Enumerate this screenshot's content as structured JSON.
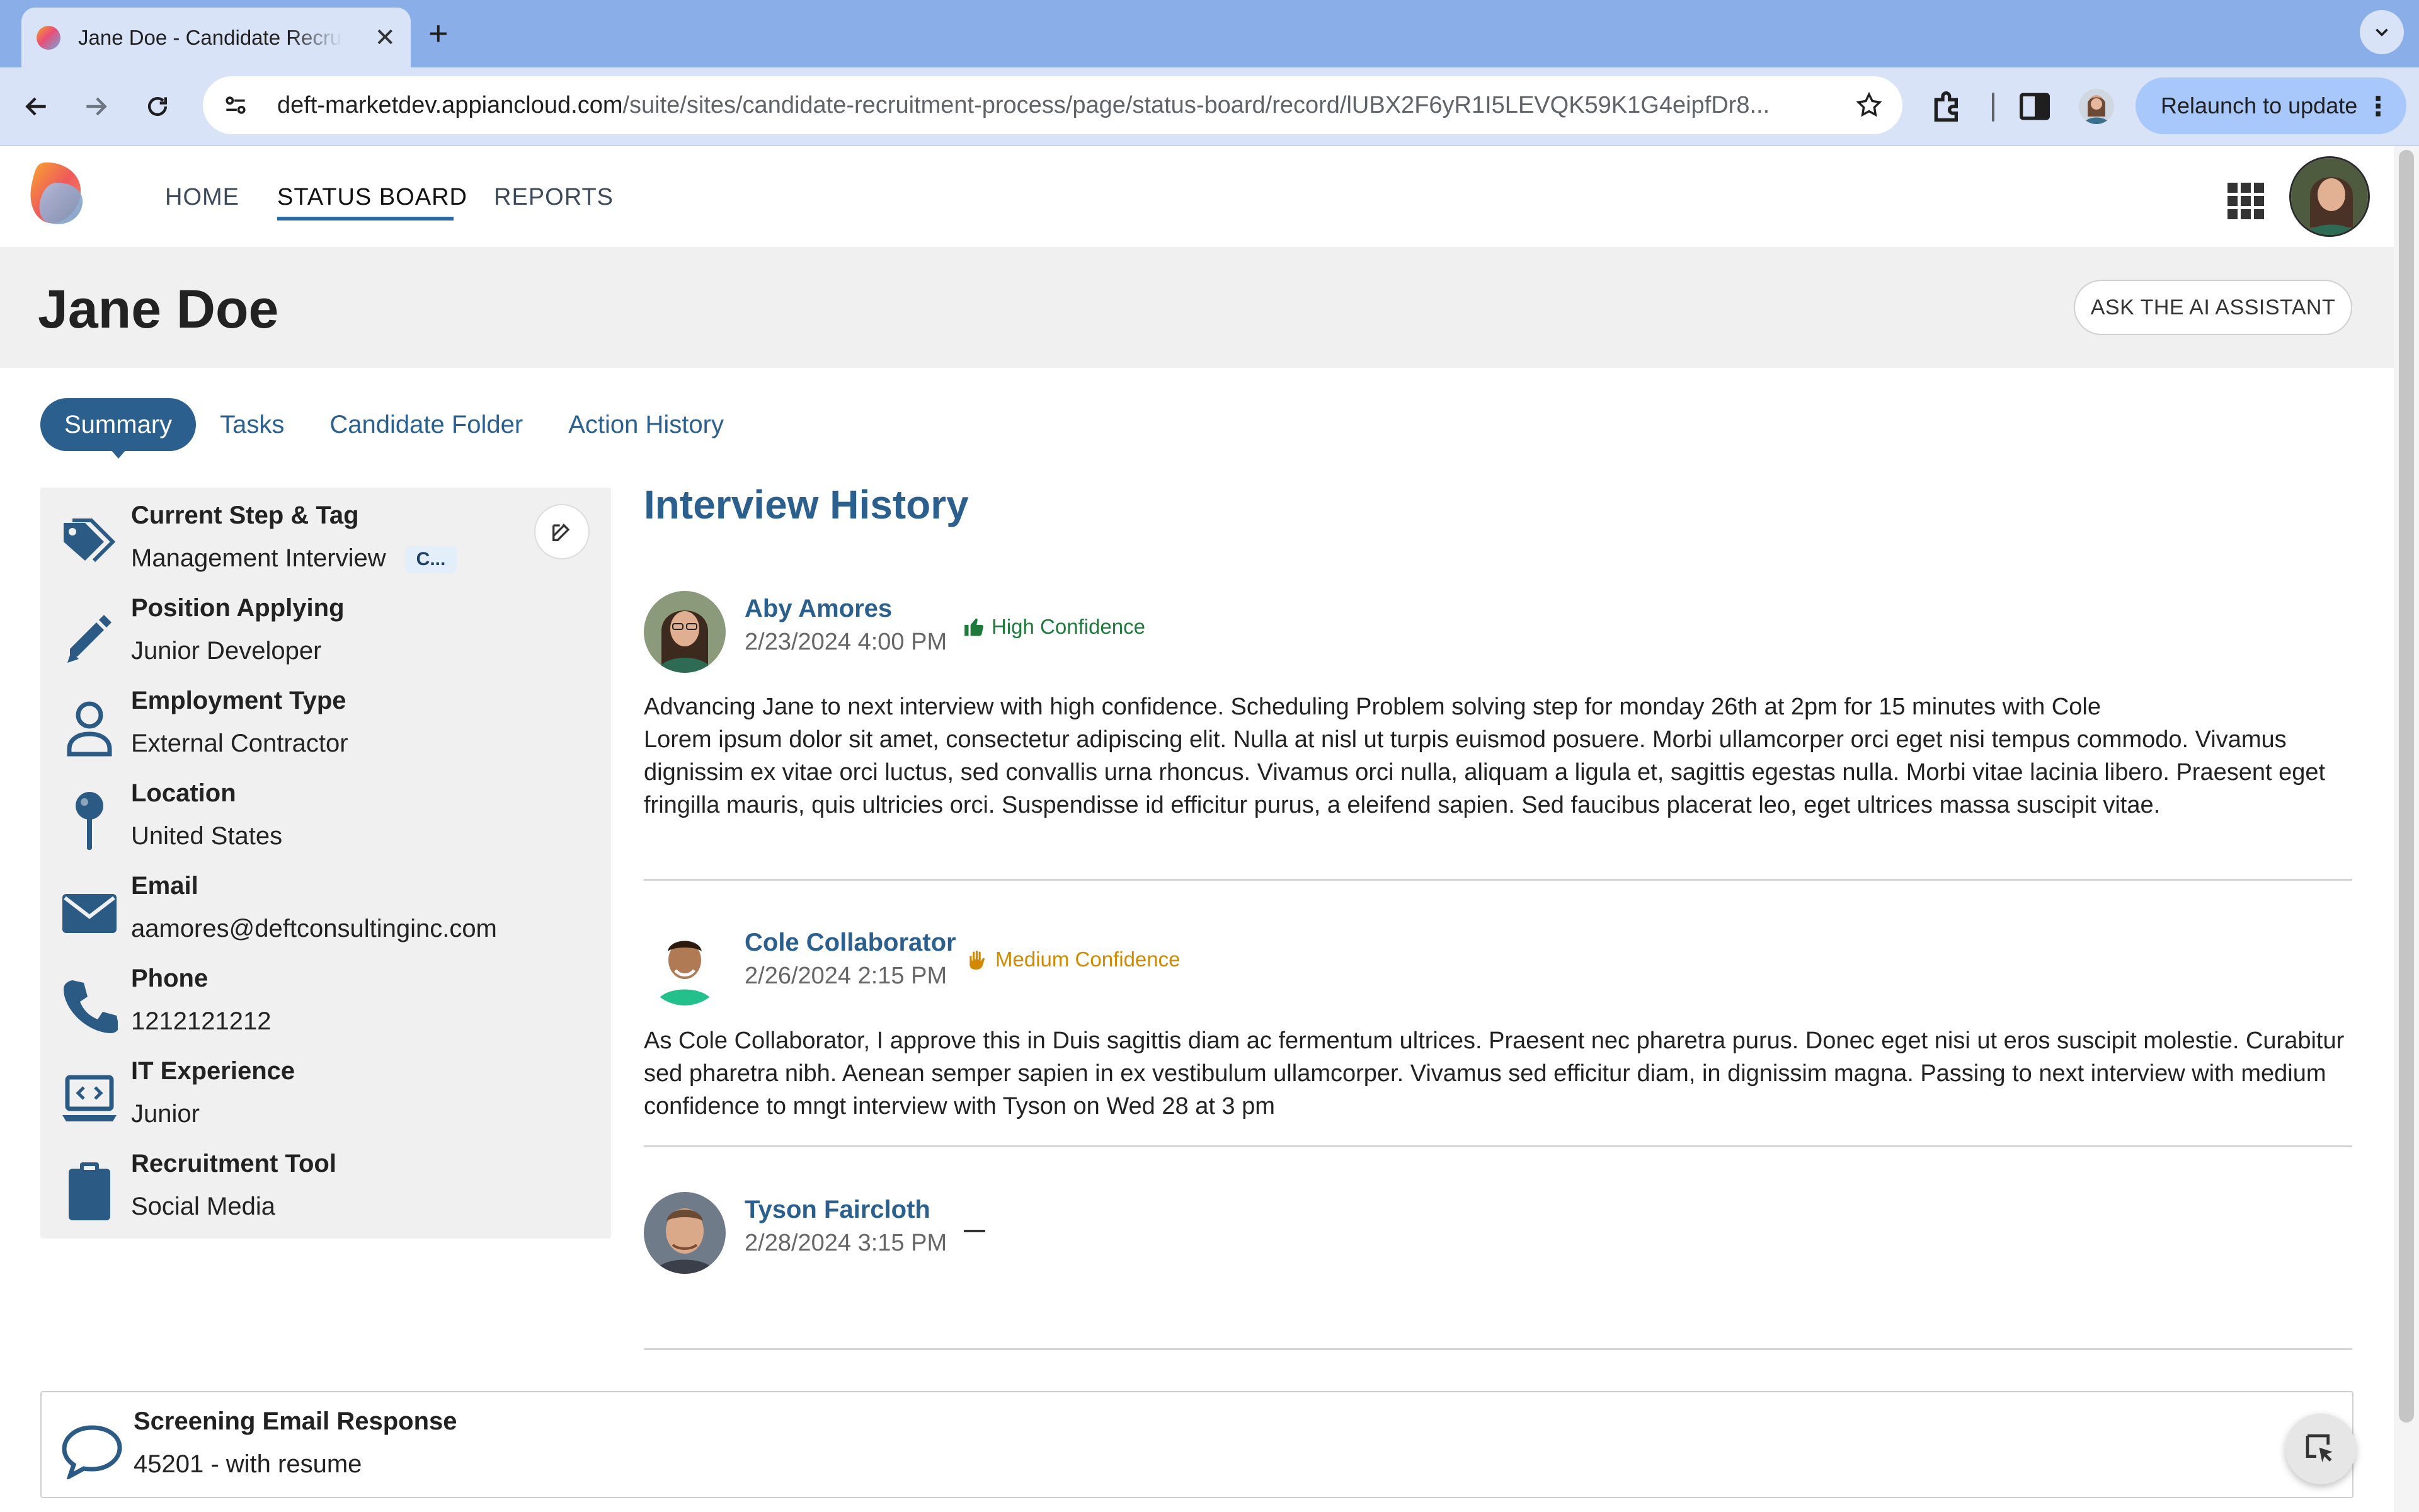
{
  "browser": {
    "tab_title": "Jane Doe - Candidate Recruitment Process",
    "url_host": "deft-marketdev.appiancloud.com",
    "url_path": "/suite/sites/candidate-recruitment-process/page/status-board/record/lUBX2F6yR1I5LEVQK59K1G4eipfDr8...",
    "relaunch_label": "Relaunch to update"
  },
  "nav": {
    "home": "HOME",
    "status_board": "STATUS BOARD",
    "reports": "REPORTS"
  },
  "page": {
    "title": "Jane Doe",
    "ai_button": "ASK THE AI ASSISTANT"
  },
  "tabs": [
    {
      "label": "Summary",
      "active": true
    },
    {
      "label": "Tasks"
    },
    {
      "label": "Candidate Folder"
    },
    {
      "label": "Action History"
    }
  ],
  "info": {
    "step": {
      "label": "Current Step & Tag",
      "value": "Management Interview",
      "tag": "C..."
    },
    "position": {
      "label": "Position Applying",
      "value": "Junior Developer"
    },
    "employment": {
      "label": "Employment Type",
      "value": "External Contractor"
    },
    "location": {
      "label": "Location",
      "value": "United States"
    },
    "email": {
      "label": "Email",
      "value": "aamores@deftconsultinginc.com"
    },
    "phone": {
      "label": "Phone",
      "value": "1212121212"
    },
    "experience": {
      "label": "IT Experience",
      "value": "Junior"
    },
    "tool": {
      "label": "Recruitment Tool",
      "value": "Social Media"
    }
  },
  "interview_history": {
    "title": "Interview History",
    "entries": [
      {
        "name": "Aby Amores",
        "date": "2/23/2024 4:00 PM",
        "confidence": "High Confidence",
        "text": "Advancing Jane to next interview with high confidence. Scheduling Problem solving step for monday 26th at 2pm for 15 minutes with Cole\nLorem ipsum dolor sit amet, consectetur adipiscing elit. Nulla at nisl ut turpis euismod posuere. Morbi ullamcorper orci eget nisi tempus commodo. Vivamus dignissim ex vitae orci luctus, sed convallis urna rhoncus. Vivamus orci nulla, aliquam a ligula et, sagittis egestas nulla. Morbi vitae lacinia libero. Praesent eget fringilla mauris, quis ultricies orci. Suspendisse id efficitur purus, a eleifend sapien. Sed faucibus placerat leo, eget ultrices massa suscipit vitae."
      },
      {
        "name": "Cole Collaborator",
        "date": "2/26/2024 2:15 PM",
        "confidence": "Medium Confidence",
        "text": "As Cole Collaborator, I approve this in Duis sagittis diam ac fermentum ultrices. Praesent nec pharetra purus. Donec eget nisi ut eros suscipit molestie. Curabitur sed pharetra nibh. Aenean semper sapien in ex vestibulum ullamcorper. Vivamus sed efficitur diam, in dignissim magna. Passing to next interview with medium confidence to mngt interview with Tyson on Wed 28 at 3 pm"
      },
      {
        "name": "Tyson Faircloth",
        "date": "2/28/2024 3:15 PM"
      }
    ]
  },
  "screening": {
    "label": "Screening Email Response",
    "value": "45201 - with resume"
  },
  "icons": {
    "tag": "tag-icon",
    "pencil": "pencil-icon",
    "person": "person-icon",
    "pin": "pin-icon",
    "mail": "mail-icon",
    "phone": "phone-icon",
    "laptop": "laptop-code-icon",
    "clipboard": "clipboard-icon",
    "chat": "chat-bubble-icon"
  },
  "colors": {
    "accent": "#2b5f8e",
    "high_confidence": "#1d7a3a",
    "medium_confidence": "#d18a00",
    "icon": "#2b5a84"
  }
}
